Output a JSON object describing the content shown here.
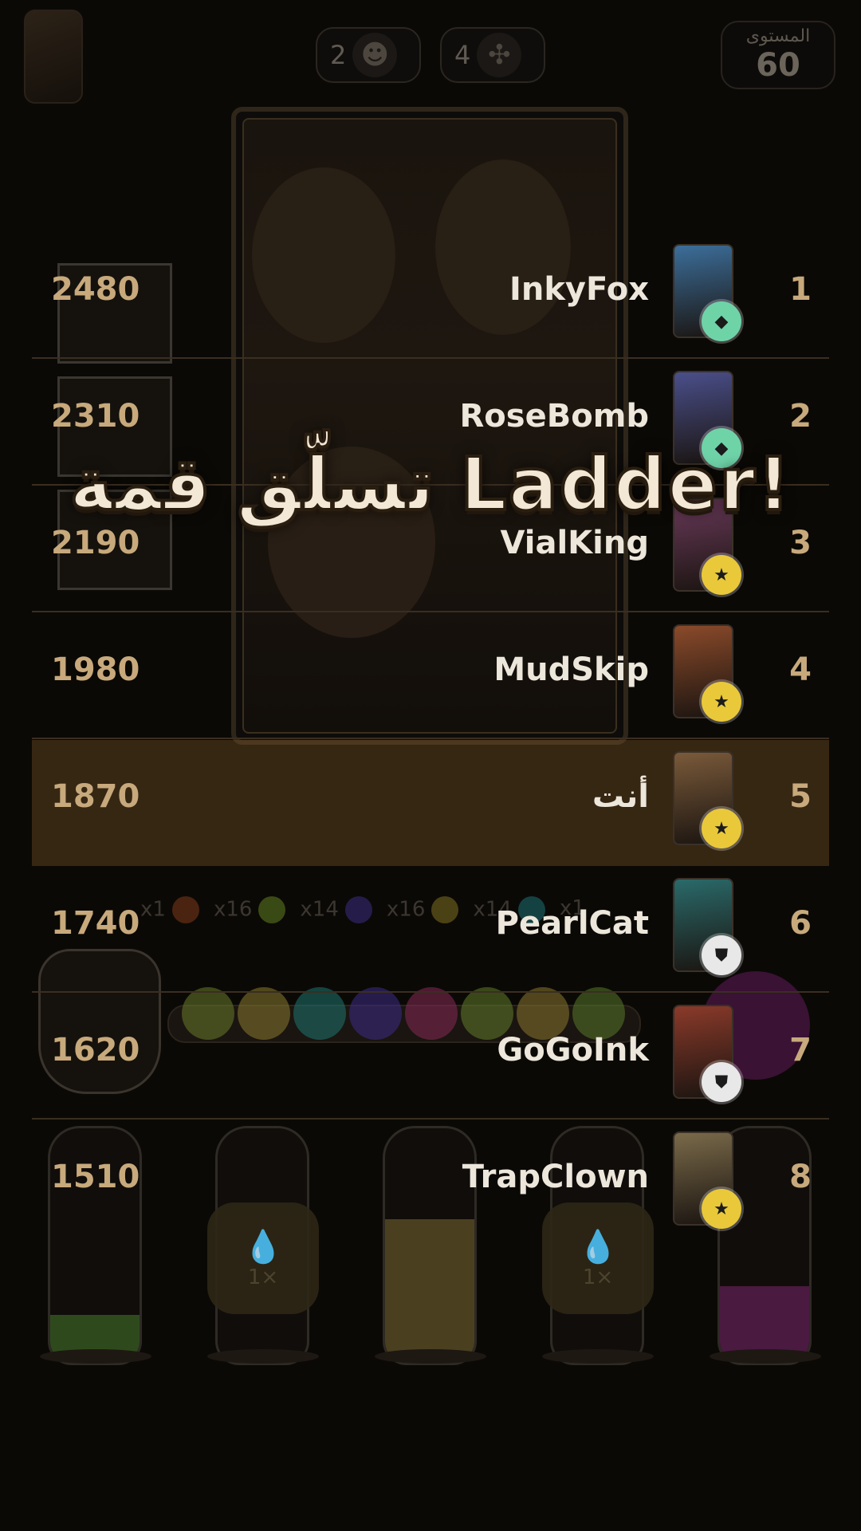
{
  "header": {
    "level_label": "المستوى",
    "level_value": "60",
    "pill_left_count": "2",
    "pill_left_icon": "character-portrait-icon",
    "pill_right_count": "4",
    "pill_right_icon": "octopus-icon"
  },
  "background": {
    "counts": [
      {
        "label": "x1",
        "color": "#7a3a12"
      },
      {
        "label": "x16",
        "color": "#5d7a1c"
      },
      {
        "label": "x14",
        "color": "#3a2a7a"
      },
      {
        "label": "x16",
        "color": "#7a6a1c"
      },
      {
        "label": "x14",
        "color": "#1c6a6a"
      },
      {
        "label": "x1",
        "color": "#444"
      }
    ],
    "ball_colors": [
      "#8fa63a",
      "#c9b345",
      "#2aa6a0",
      "#5a3fc1",
      "#c23a7a",
      "#8fb33a",
      "#c9a945",
      "#7fae3a"
    ],
    "bottle_buttons": [
      {
        "label": "1×",
        "icon": "drop-icon"
      },
      {
        "label": "1×",
        "icon": "drop-icon"
      }
    ]
  },
  "headline": "تسلّق قمة Ladder!",
  "leaderboard": [
    {
      "rank": "1",
      "name": "InkyFox",
      "score": "2480",
      "badge": "diamond-badge-icon",
      "badge_color": "#6fd3a8",
      "avatar_color": "#3c6e9a"
    },
    {
      "rank": "2",
      "name": "RoseBomb",
      "score": "2310",
      "badge": "diamond-badge-icon",
      "badge_color": "#6fd3a8",
      "avatar_color": "#4a4f8a"
    },
    {
      "rank": "3",
      "name": "VialKing",
      "score": "2190",
      "badge": "star-badge-icon",
      "badge_color": "#e9c93a",
      "avatar_color": "#6a3a5a"
    },
    {
      "rank": "4",
      "name": "MudSkip",
      "score": "1980",
      "badge": "star-badge-icon",
      "badge_color": "#e9c93a",
      "avatar_color": "#8a4a2a"
    },
    {
      "rank": "5",
      "name": "أنت",
      "score": "1870",
      "badge": "star-badge-icon",
      "badge_color": "#e9c93a",
      "avatar_color": "#7a5a3a",
      "is_me": true
    },
    {
      "rank": "6",
      "name": "PearlCat",
      "score": "1740",
      "badge": "shield-badge-icon",
      "badge_color": "#e8e8e8",
      "avatar_color": "#2a6a6a"
    },
    {
      "rank": "7",
      "name": "GoGoInk",
      "score": "1620",
      "badge": "shield-badge-icon",
      "badge_color": "#e8e8e8",
      "avatar_color": "#8a3a2a"
    },
    {
      "rank": "8",
      "name": "TrapClown",
      "score": "1510",
      "badge": "star-badge-icon",
      "badge_color": "#e9c93a",
      "avatar_color": "#7a6a4a"
    }
  ]
}
